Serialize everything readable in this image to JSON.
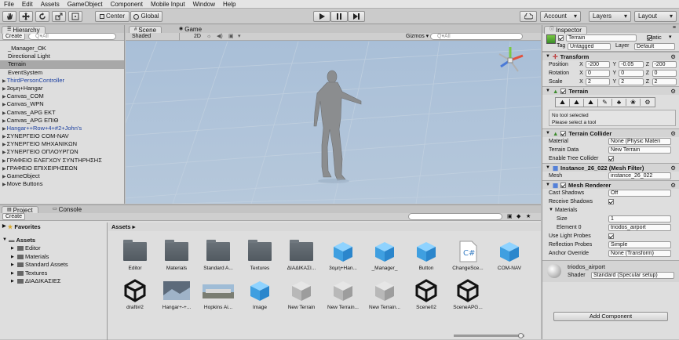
{
  "menu": [
    "File",
    "Edit",
    "Assets",
    "GameObject",
    "Component",
    "Mobile Input",
    "Window",
    "Help"
  ],
  "toolbar": {
    "center_label": "Center",
    "global_label": "Global",
    "account_label": "Account",
    "layers_label": "Layers",
    "layout_label": "Layout"
  },
  "hierarchy": {
    "tab": "Hierarchy",
    "create": "Create",
    "search": "Q▾All",
    "items": [
      {
        "label": "_Manager_OK",
        "arrow": false,
        "blue": false,
        "selected": false
      },
      {
        "label": "Directional Light",
        "arrow": false,
        "blue": false,
        "selected": false
      },
      {
        "label": "Terrain",
        "arrow": false,
        "blue": false,
        "selected": true
      },
      {
        "label": "EventSystem",
        "arrow": false,
        "blue": false,
        "selected": false
      },
      {
        "label": "ThirdPersonController",
        "arrow": true,
        "blue": true,
        "selected": false
      },
      {
        "label": "3ομη+Hangar",
        "arrow": true,
        "blue": false,
        "selected": false
      },
      {
        "label": "Canvas_COM",
        "arrow": true,
        "blue": false,
        "selected": false
      },
      {
        "label": "Canvas_WPN",
        "arrow": true,
        "blue": false,
        "selected": false
      },
      {
        "label": "Canvas_APG ΕΚΤ",
        "arrow": true,
        "blue": false,
        "selected": false
      },
      {
        "label": "Canvas_APG ΕΠΙΘ",
        "arrow": true,
        "blue": false,
        "selected": false
      },
      {
        "label": "Hangar++Row+4+#2+John's",
        "arrow": true,
        "blue": true,
        "selected": false
      },
      {
        "label": "ΣΥΝΕΡΓΕΙΟ COM-NAV",
        "arrow": true,
        "blue": false,
        "selected": false
      },
      {
        "label": "ΣΥΝΕΡΓΕΙΟ ΜΗΧΑΝΙΚΩΝ",
        "arrow": true,
        "blue": false,
        "selected": false
      },
      {
        "label": "ΣΥΝΕΡΓΕΙΟ ΟΠΛΟΥΡΓΩΝ",
        "arrow": true,
        "blue": false,
        "selected": false
      },
      {
        "label": "ΓΡΑΦΕΙΟ ΕΛΕΓΧΟΥ ΣΥΝΤΗΡΗΣΗΣ",
        "arrow": true,
        "blue": false,
        "selected": false
      },
      {
        "label": "ΓΡΑΦΕΙΟ ΕΠΙΧΕΙΡΗΣΕΩΝ",
        "arrow": true,
        "blue": false,
        "selected": false
      },
      {
        "label": "GameObject",
        "arrow": true,
        "blue": false,
        "selected": false
      },
      {
        "label": "Move Buttons",
        "arrow": true,
        "blue": false,
        "selected": false
      }
    ]
  },
  "scene": {
    "tab_scene": "Scene",
    "tab_game": "Game",
    "shaded": "Shaded",
    "mode2d": "2D",
    "gizmos": "Gizmos ▾",
    "search": "Q▾All"
  },
  "inspector": {
    "tab": "Inspector",
    "object_name": "Terrain",
    "static_label": "Static",
    "tag_label": "Tag",
    "tag_value": "Untagged",
    "layer_label": "Layer",
    "layer_value": "Default",
    "transform": {
      "title": "Transform",
      "position_label": "Position",
      "px": "-200",
      "py": "-0.05",
      "pz": "-200",
      "rotation_label": "Rotation",
      "rx": "0",
      "ry": "0",
      "rz": "0",
      "scale_label": "Scale",
      "sx": "2",
      "sy": "2",
      "sz": "2"
    },
    "terrain": {
      "title": "Terrain",
      "no_tool": "No tool selected",
      "select_tool": "Please select a tool"
    },
    "collider": {
      "title": "Terrain Collider",
      "material_label": "Material",
      "material_value": "None (Physic Materi",
      "data_label": "Terrain Data",
      "data_value": "New Terrain",
      "tree_label": "Enable Tree Collider"
    },
    "mesh_filter": {
      "title": "Instance_26_022 (Mesh Filter)",
      "mesh_label": "Mesh",
      "mesh_value": "instance_26_022"
    },
    "mesh_renderer": {
      "title": "Mesh Renderer",
      "cast_label": "Cast Shadows",
      "cast_value": "Off",
      "receive_label": "Receive Shadows",
      "materials_label": "Materials",
      "size_label": "Size",
      "size_value": "1",
      "element_label": "Element 0",
      "element_value": "triodos_airport",
      "probes_label": "Use Light Probes",
      "reflection_label": "Reflection Probes",
      "reflection_value": "Simple",
      "anchor_label": "Anchor Override",
      "anchor_value": "None (Transform)"
    },
    "material": {
      "name": "triodos_airport",
      "shader_label": "Shader",
      "shader_value": "Standard (Specular setup)"
    },
    "add_component": "Add Component"
  },
  "project": {
    "tab_project": "Project",
    "tab_console": "Console",
    "create": "Create",
    "favorites": "Favorites",
    "assets_root": "Assets",
    "tree": [
      "Editor",
      "Materials",
      "Standard Assets",
      "Textures",
      "ΔΙΑΔΙΚΑΣΙΕΣ"
    ],
    "breadcrumb": "Assets ▸",
    "row1": [
      {
        "label": "Editor",
        "type": "folder"
      },
      {
        "label": "Materials",
        "type": "folder"
      },
      {
        "label": "Standard A...",
        "type": "folder"
      },
      {
        "label": "Textures",
        "type": "folder"
      },
      {
        "label": "ΔΙΑΔΙΚΑΣΙ...",
        "type": "folder"
      },
      {
        "label": "3ομη+Han...",
        "type": "cube"
      },
      {
        "label": "_Manager_",
        "type": "cube"
      },
      {
        "label": "Button",
        "type": "cube"
      },
      {
        "label": "ChangeSce...",
        "type": "script"
      },
      {
        "label": "COM-NAV",
        "type": "cube"
      }
    ],
    "row2": [
      {
        "label": "drafti#2",
        "type": "unity"
      },
      {
        "label": "Hangar+-+...",
        "type": "image"
      },
      {
        "label": "Hopkins Ai...",
        "type": "photo"
      },
      {
        "label": "Image",
        "type": "cube"
      },
      {
        "label": "New Terrain",
        "type": "greycube"
      },
      {
        "label": "New Terrain...",
        "type": "greycube"
      },
      {
        "label": "New Terrain...",
        "type": "greycube"
      },
      {
        "label": "Scene02",
        "type": "unity"
      },
      {
        "label": "SceneAPG...",
        "type": "unity"
      }
    ]
  },
  "colors": {
    "scene_bg": "#a6bdd6",
    "selection": "#a8a8a8",
    "link_blue": "#1b3fa0",
    "cube_blue": "#49a9e6"
  }
}
